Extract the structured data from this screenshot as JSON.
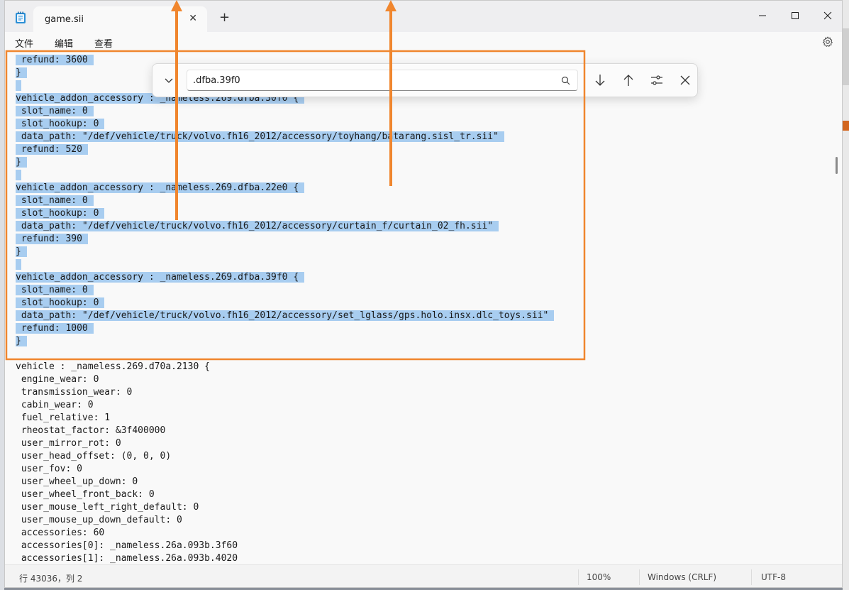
{
  "tab": {
    "title": "game.sii"
  },
  "menu": {
    "file": "文件",
    "edit": "编辑",
    "view": "查看"
  },
  "find": {
    "query": ".dfba.39f0"
  },
  "editor": {
    "lines": [
      {
        "text": " refund: 3600",
        "selected": true
      },
      {
        "text": "}",
        "selected": true
      },
      {
        "text": "",
        "selected": true
      },
      {
        "text": "vehicle_addon_accessory : _nameless.269.dfba.30f0 {",
        "selected": true
      },
      {
        "text": " slot_name: 0",
        "selected": true
      },
      {
        "text": " slot_hookup: 0",
        "selected": true
      },
      {
        "text": " data_path: \"/def/vehicle/truck/volvo.fh16_2012/accessory/toyhang/batarang.sisl_tr.sii\"",
        "selected": true
      },
      {
        "text": " refund: 520",
        "selected": true
      },
      {
        "text": "}",
        "selected": true
      },
      {
        "text": "",
        "selected": true
      },
      {
        "text": "vehicle_addon_accessory : _nameless.269.dfba.22e0 {",
        "selected": true
      },
      {
        "text": " slot_name: 0",
        "selected": true
      },
      {
        "text": " slot_hookup: 0",
        "selected": true
      },
      {
        "text": " data_path: \"/def/vehicle/truck/volvo.fh16_2012/accessory/curtain_f/curtain_02_fh.sii\"",
        "selected": true
      },
      {
        "text": " refund: 390",
        "selected": true
      },
      {
        "text": "}",
        "selected": true
      },
      {
        "text": "",
        "selected": true
      },
      {
        "text": "vehicle_addon_accessory : _nameless.269.dfba.39f0 {",
        "selected": true
      },
      {
        "text": " slot_name: 0",
        "selected": true
      },
      {
        "text": " slot_hookup: 0",
        "selected": true
      },
      {
        "text": " data_path: \"/def/vehicle/truck/volvo.fh16_2012/accessory/set_lglass/gps.holo.insx.dlc_toys.sii\"",
        "selected": true
      },
      {
        "text": " refund: 1000",
        "selected": true
      },
      {
        "text": "}",
        "selected": true
      },
      {
        "text": "",
        "selected": false
      },
      {
        "text": "vehicle : _nameless.269.d70a.2130 {",
        "selected": false
      },
      {
        "text": " engine_wear: 0",
        "selected": false
      },
      {
        "text": " transmission_wear: 0",
        "selected": false
      },
      {
        "text": " cabin_wear: 0",
        "selected": false
      },
      {
        "text": " fuel_relative: 1",
        "selected": false
      },
      {
        "text": " rheostat_factor: &3f400000",
        "selected": false
      },
      {
        "text": " user_mirror_rot: 0",
        "selected": false
      },
      {
        "text": " user_head_offset: (0, 0, 0)",
        "selected": false
      },
      {
        "text": " user_fov: 0",
        "selected": false
      },
      {
        "text": " user_wheel_up_down: 0",
        "selected": false
      },
      {
        "text": " user_wheel_front_back: 0",
        "selected": false
      },
      {
        "text": " user_mouse_left_right_default: 0",
        "selected": false
      },
      {
        "text": " user_mouse_up_down_default: 0",
        "selected": false
      },
      {
        "text": " accessories: 60",
        "selected": false
      },
      {
        "text": " accessories[0]: _nameless.26a.093b.3f60",
        "selected": false
      },
      {
        "text": " accessories[1]: _nameless.26a.093b.4020",
        "selected": false
      }
    ]
  },
  "status": {
    "position": "行 43036，列 2",
    "zoom": "100%",
    "line_ending": "Windows (CRLF)",
    "encoding": "UTF-8"
  },
  "colors": {
    "selection": "#a8cdf0",
    "annotation": "#f0862e"
  }
}
